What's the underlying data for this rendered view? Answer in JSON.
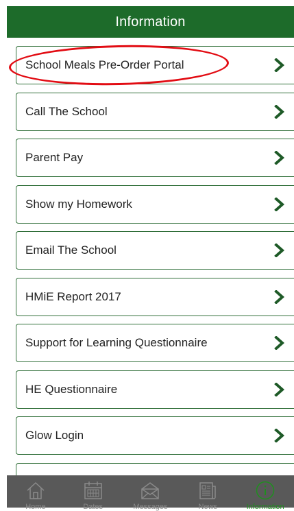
{
  "header": {
    "title": "Information"
  },
  "items": [
    {
      "label": "School Meals Pre-Order Portal"
    },
    {
      "label": "Call The School"
    },
    {
      "label": "Parent Pay"
    },
    {
      "label": "Show my Homework"
    },
    {
      "label": "Email The School"
    },
    {
      "label": "HMiE Report 2017"
    },
    {
      "label": "Support for Learning Questionnaire"
    },
    {
      "label": "HE Questionnaire"
    },
    {
      "label": "Glow Login"
    },
    {
      "label": ""
    }
  ],
  "tabbar": {
    "tabs": [
      {
        "label": "Home",
        "icon": "home-icon"
      },
      {
        "label": "Dates",
        "icon": "calendar-icon"
      },
      {
        "label": "Messages",
        "icon": "envelope-icon"
      },
      {
        "label": "News",
        "icon": "newspaper-icon"
      },
      {
        "label": "Information",
        "icon": "info-icon",
        "active": true
      }
    ]
  },
  "colors": {
    "header": "#1d6b2a",
    "border": "#2f6e38",
    "chevron": "#1e5a27",
    "highlight": "#e20c13",
    "tabbar": "#595959",
    "active_tab": "#1f8f1f"
  }
}
